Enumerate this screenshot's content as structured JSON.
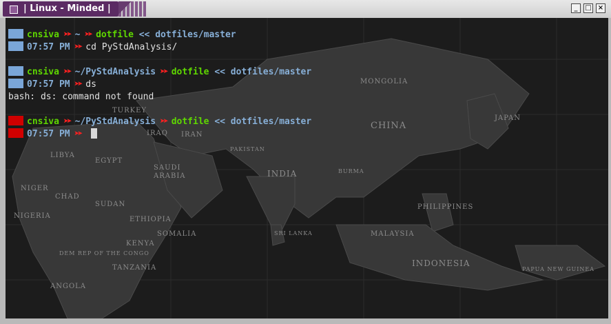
{
  "window": {
    "title": "| Linux - Minded |",
    "buttons": {
      "minimize": "_",
      "maximize": "□",
      "close": "×"
    }
  },
  "colors": {
    "user": "#5fd700",
    "path": "#87afd7",
    "git": "#87afd7",
    "arrow": "#ff2020",
    "ok_square": "#7aa6d8",
    "err_square": "#d00000",
    "text": "#e0e0e0"
  },
  "icons": {
    "menu": "window-menu-icon",
    "arrow": "double-chevron-icon",
    "status": "status-square-icon"
  },
  "terminal": {
    "blocks": [
      {
        "status": "ok",
        "prompt": {
          "user": "cnsiva",
          "path": "~",
          "dir": "dotfile",
          "git": "<< dotfiles/master"
        },
        "time": "07:57 PM",
        "command": "cd PyStdAnalysis/",
        "output": ""
      },
      {
        "status": "ok",
        "prompt": {
          "user": "cnsiva",
          "path": "~/PyStdAnalysis",
          "dir": "dotfile",
          "git": "<< dotfiles/master"
        },
        "time": "07:57 PM",
        "command": "ds",
        "output": "bash: ds: command not found"
      },
      {
        "status": "err",
        "prompt": {
          "user": "cnsiva",
          "path": "~/PyStdAnalysis",
          "dir": "dotfile",
          "git": "<< dotfiles/master"
        },
        "time": "07:57 PM",
        "command": "",
        "output": ""
      }
    ]
  },
  "map_labels": {
    "mongolia": "MONGOLIA",
    "china": "CHINA",
    "india": "INDIA",
    "iran": "IRAN",
    "saudi": "SAUDI",
    "arabia": "ARABIA",
    "egypt": "EGYPT",
    "libya": "LIBYA",
    "sudan": "SUDAN",
    "chad": "CHAD",
    "niger": "NIGER",
    "nigeria": "NIGERIA",
    "ethiopia": "ETHIOPIA",
    "somalia": "SOMALIA",
    "kenya": "KENYA",
    "tanzania": "TANZANIA",
    "angola": "ANGOLA",
    "congo": "DEM REP OF THE CONGO",
    "turkey": "TURKEY",
    "iraq": "IRAQ",
    "pakistan": "PAKISTAN",
    "japan": "JAPAN",
    "philippines": "PHILIPPINES",
    "malaysia": "MALAYSIA",
    "indonesia": "INDONESIA",
    "burma": "BURMA",
    "sri_lanka": "SRI LANKA",
    "papua": "PAPUA NEW GUINEA"
  }
}
